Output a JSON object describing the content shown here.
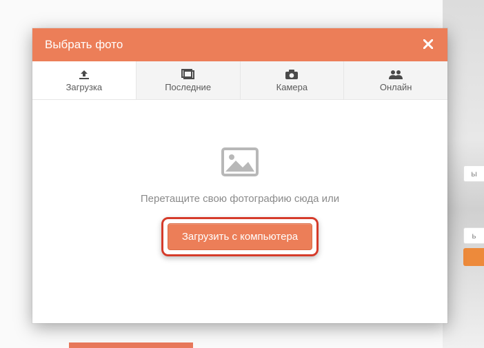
{
  "modal": {
    "title": "Выбрать фото",
    "tabs": [
      {
        "label": "Загрузка",
        "icon": "upload-icon",
        "active": true
      },
      {
        "label": "Последние",
        "icon": "recent-icon",
        "active": false
      },
      {
        "label": "Камера",
        "icon": "camera-icon",
        "active": false
      },
      {
        "label": "Онлайн",
        "icon": "online-icon",
        "active": false
      }
    ],
    "drop_text": "Перетащите свою фотографию сюда или",
    "upload_button": "Загрузить с компьютера"
  },
  "colors": {
    "accent": "#ec7e58",
    "highlight_ring": "#d53b2a"
  }
}
